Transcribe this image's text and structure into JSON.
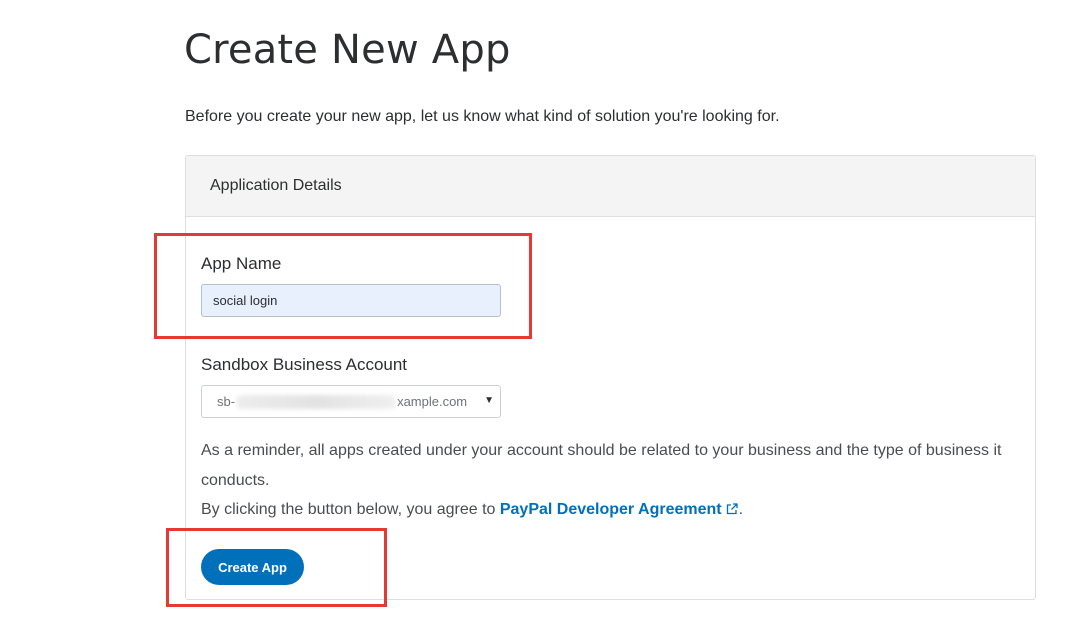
{
  "page": {
    "title": "Create New App",
    "intro": "Before you create your new app, let us know what kind of solution you're looking for."
  },
  "panel": {
    "header": "Application Details",
    "app_name": {
      "label": "App Name",
      "value": "social login"
    },
    "sandbox": {
      "label": "Sandbox Business Account",
      "value_prefix": "sb-",
      "value_suffix": "xample.com"
    },
    "reminder": "As a reminder, all apps created under your account should be related to your business and the type of business it conducts.",
    "agreement": {
      "prefix": "By clicking the button below, you agree to ",
      "link_text": "PayPal Developer Agreement",
      "suffix": "."
    },
    "create_button": "Create App"
  },
  "colors": {
    "accent": "#0070ba",
    "highlight": "#e53935",
    "input_autofill_bg": "#e8f0fe"
  },
  "icons": {
    "external_link": "external-link-icon",
    "dropdown": "chevron-down-icon"
  }
}
